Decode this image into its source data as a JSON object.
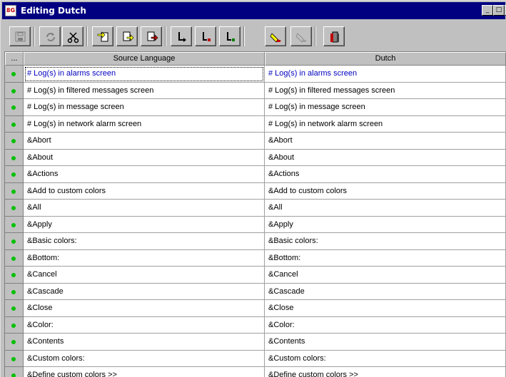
{
  "window": {
    "title": "Editing Dutch",
    "app_icon_text": "8G"
  },
  "titlebar_buttons": {
    "minimize": "_",
    "maximize": "□",
    "close": "×"
  },
  "toolbar": {
    "tools": [
      {
        "name": "save-tool",
        "icon": "floppy-disk-icon",
        "enabled": false
      },
      {
        "name": "refresh-tool",
        "icon": "refresh-icon",
        "enabled": false
      },
      {
        "name": "cut-tool",
        "icon": "scissors-icon",
        "enabled": true
      },
      {
        "name": "import-tool-1",
        "icon": "document-arrow-icon",
        "enabled": true
      },
      {
        "name": "import-tool-2",
        "icon": "document-arrow-icon",
        "enabled": true
      },
      {
        "name": "import-tool-3",
        "icon": "document-red-arrow-icon",
        "enabled": true
      },
      {
        "name": "jump-tool-1",
        "icon": "down-right-arrow-icon",
        "enabled": true
      },
      {
        "name": "jump-tool-2",
        "icon": "down-right-arrow-red-icon",
        "enabled": true
      },
      {
        "name": "jump-tool-3",
        "icon": "down-right-arrow-green-icon",
        "enabled": true
      },
      {
        "name": "highlight-tool",
        "icon": "highlighter-icon",
        "enabled": true
      },
      {
        "name": "highlight-clear-tool",
        "icon": "highlighter-disabled-icon",
        "enabled": false
      },
      {
        "name": "exit-tool",
        "icon": "door-icon",
        "enabled": true
      }
    ],
    "colors": {
      "accent_red": "#c00000",
      "accent_green": "#008000",
      "accent_yellow": "#ffff00"
    }
  },
  "grid": {
    "columns": {
      "indicator": "...",
      "source": "Source Language",
      "target": "Dutch"
    },
    "status_color": "#00c000",
    "rows": [
      {
        "source": "# Log(s) in alarms screen",
        "target": "# Log(s) in alarms screen"
      },
      {
        "source": "# Log(s) in filtered messages screen",
        "target": "# Log(s) in filtered messages screen"
      },
      {
        "source": "# Log(s) in message screen",
        "target": "# Log(s) in message screen"
      },
      {
        "source": "# Log(s) in network alarm screen",
        "target": "# Log(s) in network alarm screen"
      },
      {
        "source": "&Abort",
        "target": "&Abort"
      },
      {
        "source": "&About",
        "target": "&About"
      },
      {
        "source": "&Actions",
        "target": "&Actions"
      },
      {
        "source": "&Add to custom colors",
        "target": "&Add to custom colors"
      },
      {
        "source": "&All",
        "target": "&All"
      },
      {
        "source": "&Apply",
        "target": "&Apply"
      },
      {
        "source": "&Basic colors:",
        "target": "&Basic colors:"
      },
      {
        "source": "&Bottom:",
        "target": "&Bottom:"
      },
      {
        "source": "&Cancel",
        "target": "&Cancel"
      },
      {
        "source": "&Cascade",
        "target": "&Cascade"
      },
      {
        "source": "&Close",
        "target": "&Close"
      },
      {
        "source": "&Color:",
        "target": "&Color:"
      },
      {
        "source": "&Contents",
        "target": "&Contents"
      },
      {
        "source": "&Custom colors:",
        "target": "&Custom colors:"
      },
      {
        "source": "&Define custom colors >>",
        "target": "&Define custom colors >>"
      }
    ]
  }
}
